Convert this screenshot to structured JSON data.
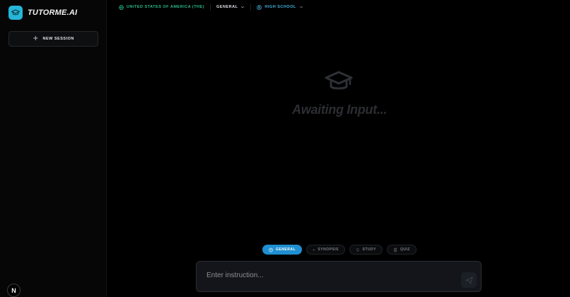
{
  "brand": {
    "name": "TUTORME.AI",
    "logo_icon": "graduation-cap-icon",
    "logo_color": "#25b6d8"
  },
  "sidebar": {
    "new_session_label": "NEW SESSION",
    "badge_letter": "N"
  },
  "topbar": {
    "country": "UNITED STATES OF AMERICA (THE)",
    "subject": "GENERAL",
    "level": "HIGH SCHOOL",
    "country_color": "#2bbd8a",
    "level_color": "#46b3e0"
  },
  "main": {
    "placeholder": "Awaiting Input..."
  },
  "modes": [
    {
      "label": "GENERAL",
      "icon": "help-circle-icon",
      "active": true
    },
    {
      "label": "SYNOPSIS",
      "icon": "sparkle-icon",
      "active": false
    },
    {
      "label": "STUDY",
      "icon": "lightbulb-icon",
      "active": false
    },
    {
      "label": "QUIZ",
      "icon": "clipboard-icon",
      "active": false
    }
  ],
  "composer": {
    "placeholder": "Enter instruction...",
    "value": ""
  },
  "colors": {
    "accent": "#1f8fd1",
    "background": "#000000"
  }
}
